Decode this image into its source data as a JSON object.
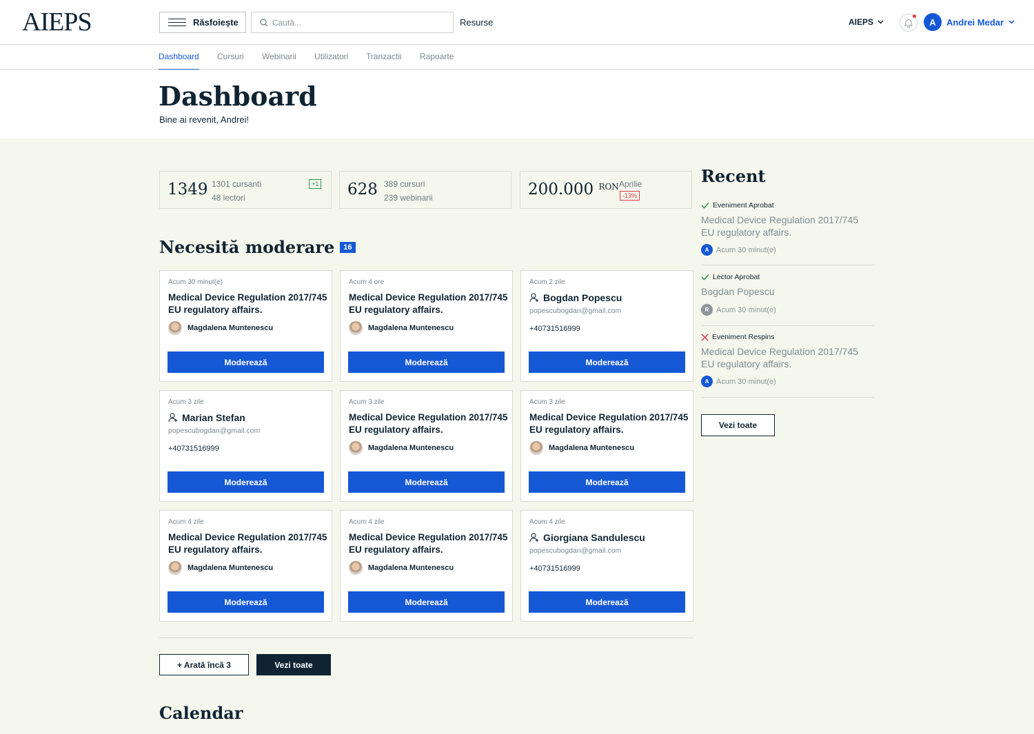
{
  "header": {
    "logo": "AIEPS",
    "browse_label": "Răsfoiește",
    "search_placeholder": "Caută...",
    "resources_label": "Resurse",
    "org_label": "AIEPS",
    "user_initial": "A",
    "user_name": "Andrei Medar"
  },
  "tabs": [
    {
      "label": "Dashboard",
      "active": true
    },
    {
      "label": "Cursuri"
    },
    {
      "label": "Webinarii"
    },
    {
      "label": "Utilizatori"
    },
    {
      "label": "Tranzactii"
    },
    {
      "label": "Rapoarte"
    }
  ],
  "page": {
    "title": "Dashboard",
    "welcome": "Bine ai revenit, Andrei!"
  },
  "stats": [
    {
      "value": "1349",
      "line1": "1301 cursanti",
      "line2": "48 lectori",
      "badge": "+1"
    },
    {
      "value": "628",
      "line1": "389 cursuri",
      "line2": "239 webinarii"
    },
    {
      "value": "200.000",
      "unit": "RON",
      "line1": "Aprilie",
      "badge": "-13%"
    }
  ],
  "moderation": {
    "title": "Necesită moderare",
    "count": "16",
    "button_label": "Moderează",
    "cards": [
      {
        "time": "Acum 30 minut(e)",
        "title": "Medical Device Regulation 2017/745 EU regulatory affairs.",
        "author": "Magdalena Muntenescu"
      },
      {
        "time": "Acum 4 ore",
        "title": "Medical Device Regulation 2017/745 EU regulatory affairs.",
        "author": "Magdalena Muntenescu"
      },
      {
        "time": "Acum 2 zile",
        "person": "Bogdan Popescu",
        "email": "popescubogdan@gmail.com",
        "phone": "+40731516999"
      },
      {
        "time": "Acum 3 zile",
        "person": "Marian Stefan",
        "email": "popescubogdan@gmail.com",
        "phone": "+40731516999"
      },
      {
        "time": "Acum 3 zile",
        "title": "Medical Device Regulation 2017/745 EU regulatory affairs.",
        "author": "Magdalena Muntenescu"
      },
      {
        "time": "Acum 3 zile",
        "title": "Medical Device Regulation 2017/745 EU regulatory affairs.",
        "author": "Magdalena Muntenescu"
      },
      {
        "time": "Acum 4 zile",
        "title": "Medical Device Regulation 2017/745 EU regulatory affairs.",
        "author": "Magdalena Muntenescu"
      },
      {
        "time": "Acum 4 zile",
        "title": "Medical Device Regulation 2017/745 EU regulatory affairs.",
        "author": "Magdalena Muntenescu"
      },
      {
        "time": "Acum 4 zile",
        "person": "Giorgiana Sandulescu",
        "email": "popescubogdan@gmail.com",
        "phone": "+40731516999"
      }
    ],
    "show_more_label": "+ Arată încă 3",
    "see_all_label": "Vezi toate"
  },
  "calendar": {
    "title": "Calendar"
  },
  "recent": {
    "title": "Recent",
    "items": [
      {
        "status": "Eveniment Aprobat",
        "kind": "approved",
        "title": "Medical Device Regulation 2017/745 EU regulatory affairs.",
        "initial": "A",
        "time": "Acum 30 minut(e)",
        "color": "#1558d6"
      },
      {
        "status": "Lector Aprobat",
        "kind": "approved",
        "title": "Bogdan Popescu",
        "initial": "R",
        "time": "Acum 30 minut(e)",
        "color": "#8b969c"
      },
      {
        "status": "Eveniment Respins",
        "kind": "rejected",
        "title": "Medical Device Regulation 2017/745 EU regulatory affairs.",
        "initial": "A",
        "time": "Acum 30 minut(e)",
        "color": "#1558d6"
      }
    ],
    "see_all_label": "Vezi toate"
  },
  "colors": {
    "accent": "#1558d6",
    "dark": "#0f2433",
    "success": "#1f9a4f",
    "danger": "#e23a4c",
    "background": "#f5f6ec"
  }
}
